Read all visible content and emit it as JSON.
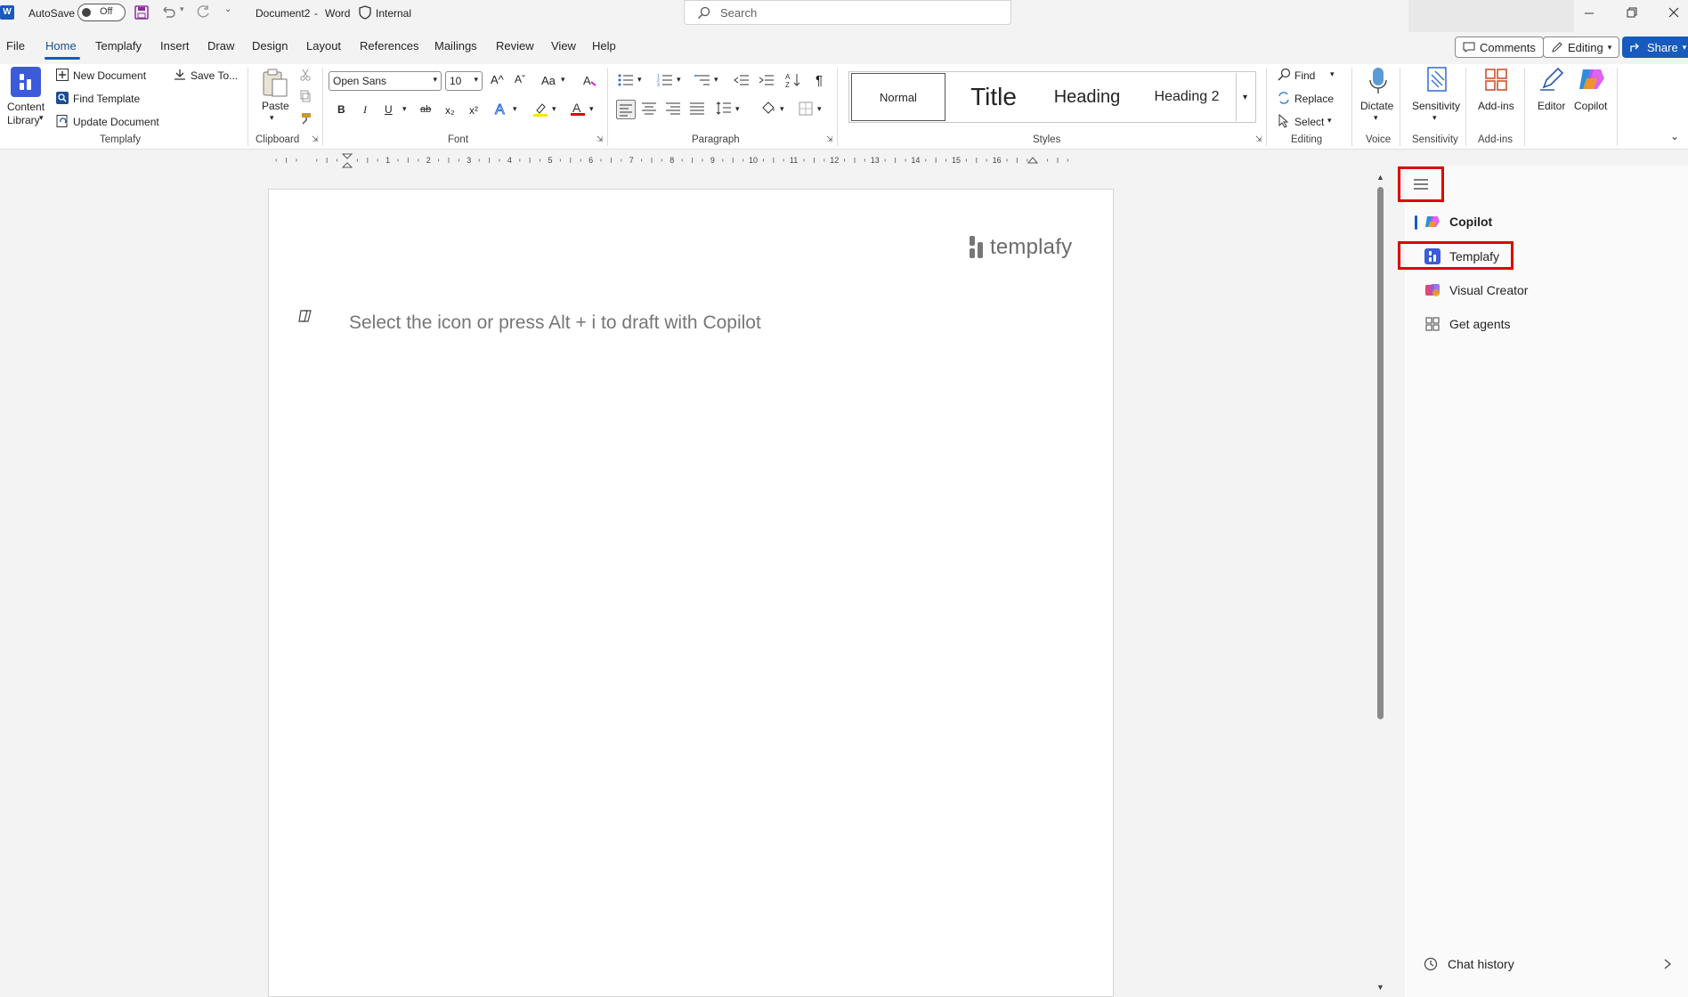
{
  "titlebar": {
    "autosave_label": "AutoSave",
    "autosave_state": "Off",
    "doc_title": "Document2",
    "separator": "-",
    "app_name": "Word",
    "sensitivity": "Internal",
    "search_placeholder": "Search"
  },
  "menu": {
    "tabs": [
      "File",
      "Home",
      "Templafy",
      "Insert",
      "Draw",
      "Design",
      "Layout",
      "References",
      "Mailings",
      "Review",
      "View",
      "Help"
    ],
    "active_tab": "Home",
    "comments_label": "Comments",
    "editing_label": "Editing",
    "share_label": "Share"
  },
  "ribbon": {
    "templafy": {
      "content_library_line1": "Content",
      "content_library_line2": "Library",
      "new_document": "New Document",
      "find_template": "Find Template",
      "update_document": "Update Document",
      "save_to": "Save To...",
      "group_label": "Templafy"
    },
    "clipboard": {
      "paste": "Paste",
      "group_label": "Clipboard"
    },
    "font": {
      "font_name": "Open Sans",
      "font_size": "10",
      "group_label": "Font",
      "bold": "B",
      "italic": "I",
      "underline": "U",
      "strike": "ab",
      "sub": "x₂",
      "sup": "x²",
      "grow": "A^",
      "shrink": "Aˇ",
      "case": "Aa"
    },
    "paragraph": {
      "group_label": "Paragraph"
    },
    "styles": {
      "items": [
        "Normal",
        "Title",
        "Heading",
        "Heading 2"
      ],
      "group_label": "Styles"
    },
    "editing": {
      "find": "Find",
      "replace": "Replace",
      "select": "Select",
      "group_label": "Editing"
    },
    "voice": {
      "dictate": "Dictate",
      "group_label": "Voice"
    },
    "sensitivity": {
      "label": "Sensitivity",
      "group_label": "Sensitivity"
    },
    "addins": {
      "label": "Add-ins",
      "group_label": "Add-ins"
    },
    "editor": {
      "label": "Editor"
    },
    "copilot": {
      "label": "Copilot"
    }
  },
  "ruler": {
    "numbers": [
      "1",
      "2",
      "3",
      "4",
      "5",
      "6",
      "7",
      "8",
      "9",
      "10",
      "11",
      "12",
      "13",
      "14",
      "15",
      "16"
    ]
  },
  "document": {
    "logo_text": "templafy",
    "placeholder": "Select the icon or press Alt + i to draft with Copilot"
  },
  "pane": {
    "items": [
      "Copilot",
      "Templafy",
      "Visual Creator",
      "Get agents"
    ],
    "chat_history": "Chat history"
  },
  "colors": {
    "accent": "#185abd",
    "highlight_box": "#e00000",
    "templafy_blue": "#3b5bdb"
  }
}
